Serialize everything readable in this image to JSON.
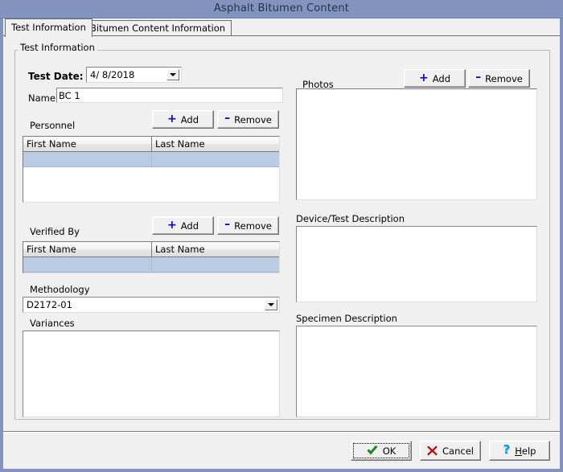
{
  "window": {
    "title": "Asphalt Bitumen Content"
  },
  "tabs": [
    {
      "label": "Test Information",
      "active": true
    },
    {
      "label": "Bitumen Content Information",
      "active": false
    }
  ],
  "group": {
    "title": "Test Information"
  },
  "fields": {
    "test_date_label": "Test Date:",
    "test_date_value": "4/  8/2018",
    "name_label": "Name:",
    "name_value": "BC 1"
  },
  "personnel": {
    "label": "Personnel",
    "add_label": "Add",
    "remove_label": "Remove",
    "plus_glyph": "+",
    "minus_glyph": "–",
    "columns": [
      "First Name",
      "Last Name"
    ],
    "rows": [
      {
        "first_name": "",
        "last_name": "",
        "selected": true
      }
    ]
  },
  "verified_by": {
    "label": "Verified By",
    "add_label": "Add",
    "remove_label": "Remove",
    "plus_glyph": "+",
    "minus_glyph": "–",
    "columns": [
      "First Name",
      "Last Name"
    ],
    "rows": [
      {
        "first_name": "",
        "last_name": "",
        "selected": true
      }
    ]
  },
  "methodology": {
    "label": "Methodology",
    "value": "D2172-01"
  },
  "variances": {
    "label": "Variances",
    "value": ""
  },
  "photos": {
    "label": "Photos",
    "add_label": "Add",
    "remove_label": "Remove",
    "plus_glyph": "+",
    "minus_glyph": "–",
    "items": []
  },
  "device_test_description": {
    "label": "Device/Test Description",
    "value": ""
  },
  "specimen_description": {
    "label": "Specimen Description",
    "value": ""
  },
  "footer": {
    "ok_label": "OK",
    "cancel_label": "Cancel",
    "help_label_pre": "H",
    "help_label_post": "elp",
    "help_glyph": "?"
  },
  "colors": {
    "titlebar": "#8293bf",
    "face": "#f0f0f0",
    "selection": "#b8cce4",
    "accent_blue": "#0000c8",
    "ok_green": "#18a018",
    "cancel_red": "#b01018",
    "help_cyan": "#0a9cc4"
  }
}
